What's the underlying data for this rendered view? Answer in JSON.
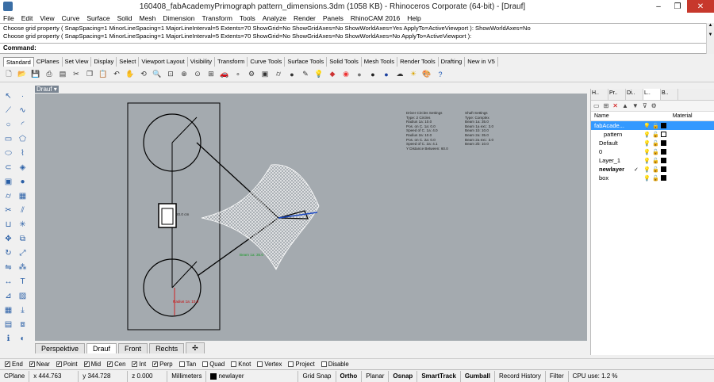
{
  "window": {
    "title": "160408_fabAcademyPrimograph pattern_dimensions.3dm (1058 KB) - Rhinoceros Corporate (64-bit) - [Drauf]"
  },
  "menu": [
    "File",
    "Edit",
    "View",
    "Curve",
    "Surface",
    "Solid",
    "Mesh",
    "Dimension",
    "Transform",
    "Tools",
    "Analyze",
    "Render",
    "Panels",
    "RhinoCAM 2016",
    "Help"
  ],
  "command_history": [
    "Choose grid property ( SnapSpacing=1  MinorLineSpacing=1  MajorLineInterval=5  Extents=70  ShowGrid=No  ShowGridAxes=No  ShowWorldAxes=Yes  ApplyTo=ActiveViewport ): ShowWorldAxes=No",
    "Choose grid property ( SnapSpacing=1  MinorLineSpacing=1  MajorLineInterval=5  Extents=70  ShowGrid=No  ShowGridAxes=No  ShowWorldAxes=No  ApplyTo=ActiveViewport ):"
  ],
  "command_prompt": "Command:",
  "toolbar_tabs": [
    "Standard",
    "CPlanes",
    "Set View",
    "Display",
    "Select",
    "Viewport Layout",
    "Visibility",
    "Transform",
    "Curve Tools",
    "Surface Tools",
    "Solid Tools",
    "Mesh Tools",
    "Render Tools",
    "Drafting",
    "New in V5"
  ],
  "toolbar_icons": [
    "new-icon",
    "open-icon",
    "save-icon",
    "print-icon",
    "import-icon",
    "cut-icon",
    "copy-icon",
    "paste-icon",
    "undo-icon",
    "pan-icon",
    "rotate-icon",
    "zoom-dynamic-icon",
    "zoom-window-icon",
    "zoom-extents-icon",
    "zoom-selected-icon",
    "4-views-icon",
    "car-icon",
    "point-icon",
    "options-icon",
    "box-icon",
    "cylinder-icon",
    "sphere-icon",
    "edit-icon",
    "lightbulb-icon",
    "layer-icon",
    "color-wheel-icon",
    "render-sphere-icon",
    "shaded-sphere-icon",
    "blue-sphere-icon",
    "fog-icon",
    "sun-icon",
    "preview-icon",
    "help-icon"
  ],
  "viewport": {
    "name": "Drauf",
    "annotations": {
      "driver_title": "Driver Circles Settings",
      "driver_lines": [
        "Type: 2 Circles",
        "Radius 1a: 10.0",
        "Pos. on C. 1a: 0.0",
        "Speed of C. 1a: 4.0",
        "Radius 2a: 10.0",
        "Pos. on C. 2a: 0.0",
        "Speed of C. 2a: 4.1",
        "Y Distance Between: 60.0"
      ],
      "shaft_title": "Shaft Settings",
      "shaft_lines": [
        "Type: Complex",
        "Beam 1a: 35.0",
        "Beam 1a ext.: 3.0",
        "Beam 1b: 10.0",
        "Beam 2a: 35.0",
        "Beam 2a ext.: 3.0",
        "Beam 2b: 10.0"
      ],
      "dim_label": "20.0 cm",
      "radius_label": "Radius 1a: 10.0",
      "green_label": "Beam 1a: 35.0"
    }
  },
  "view_tabs": [
    "Perspektive",
    "Drauf",
    "Front",
    "Rechts"
  ],
  "panel": {
    "tabs": [
      "H..",
      "Pr..",
      "Di..",
      "L..",
      "B.."
    ],
    "columns": {
      "name": "Name",
      "material": "Material"
    },
    "layers": [
      {
        "name": "fabAcade...",
        "indent": 0,
        "selected": true,
        "check": false,
        "bold": false
      },
      {
        "name": "pattern",
        "indent": 2,
        "selected": false,
        "check": false,
        "bold": false
      },
      {
        "name": "Default",
        "indent": 1,
        "selected": false,
        "check": false,
        "bold": false
      },
      {
        "name": "0",
        "indent": 1,
        "selected": false,
        "check": false,
        "bold": false
      },
      {
        "name": "Layer_1",
        "indent": 1,
        "selected": false,
        "check": false,
        "bold": false
      },
      {
        "name": "newlayer",
        "indent": 1,
        "selected": false,
        "check": true,
        "bold": true
      },
      {
        "name": "box",
        "indent": 1,
        "selected": false,
        "check": false,
        "bold": false
      }
    ],
    "checkmark": "✓"
  },
  "osnaps": [
    {
      "label": "End",
      "checked": true
    },
    {
      "label": "Near",
      "checked": true
    },
    {
      "label": "Point",
      "checked": true
    },
    {
      "label": "Mid",
      "checked": true
    },
    {
      "label": "Cen",
      "checked": true
    },
    {
      "label": "Int",
      "checked": true
    },
    {
      "label": "Perp",
      "checked": true
    },
    {
      "label": "Tan",
      "checked": false
    },
    {
      "label": "Quad",
      "checked": false
    },
    {
      "label": "Knot",
      "checked": false
    },
    {
      "label": "Vertex",
      "checked": false
    },
    {
      "label": "Project",
      "checked": false
    },
    {
      "label": "Disable",
      "checked": false
    }
  ],
  "status": {
    "cplane": "CPlane",
    "x": "x 444.763",
    "y": "y 344.728",
    "z": "z 0.000",
    "units": "Millimeters",
    "layer": "newlayer",
    "grid_snap": "Grid Snap",
    "ortho": "Ortho",
    "planar": "Planar",
    "osnap": "Osnap",
    "smarttrack": "SmartTrack",
    "gumball": "Gumball",
    "record_history": "Record History",
    "filter": "Filter",
    "cpu": "CPU use: 1.2 %"
  }
}
